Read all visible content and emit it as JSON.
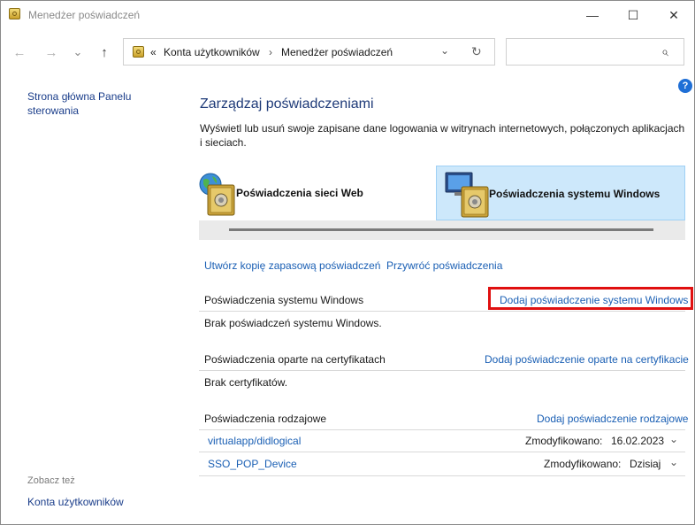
{
  "window": {
    "title": "Menedżer poświadczeń",
    "minimize_glyph": "—",
    "maximize_glyph": "☐",
    "close_glyph": "✕"
  },
  "nav": {
    "back_glyph": "←",
    "forward_glyph": "→",
    "recent_glyph": "⌄",
    "up_glyph": "↑",
    "breadcrumb_overflow": "«",
    "breadcrumb": [
      "Konta użytkowników",
      "Menedżer poświadczeń"
    ],
    "breadcrumb_sep": "›",
    "dropdown_glyph": "⌄",
    "refresh_glyph": "↻",
    "search_placeholder": "",
    "search_glyph": "⌕"
  },
  "sidebar": {
    "home_link": "Strona główna Panelu sterowania",
    "see_also_label": "Zobacz też",
    "see_also_link": "Konta użytkowników"
  },
  "main": {
    "help_glyph": "?",
    "title": "Zarządzaj poświadczeniami",
    "description": "Wyświetl lub usuń swoje zapisane dane logowania w witrynach internetowych, połączonych aplikacjach i sieciach.",
    "tabs": [
      {
        "label": "Poświadczenia sieci Web",
        "icon": "globe-vault-icon",
        "selected": false
      },
      {
        "label": "Poświadczenia systemu Windows",
        "icon": "computer-vault-icon",
        "selected": true
      }
    ],
    "backup_link": "Utwórz kopię zapasową poświadczeń",
    "restore_link": "Przywróć poświadczenia",
    "sections": [
      {
        "title": "Poświadczenia systemu Windows",
        "action": "Dodaj poświadczenie systemu Windows",
        "empty": "Brak poświadczeń systemu Windows."
      },
      {
        "title": "Poświadczenia oparte na certyfikatach",
        "action": "Dodaj poświadczenie oparte na certyfikacie",
        "empty": "Brak certyfikatów."
      },
      {
        "title": "Poświadczenia rodzajowe",
        "action": "Dodaj poświadczenie rodzajowe"
      }
    ],
    "generic_items": [
      {
        "name": "virtualapp/didlogical",
        "modified_label": "Zmodyfikowano:",
        "modified_value": "16.02.2023"
      },
      {
        "name": "SSO_POP_Device",
        "modified_label": "Zmodyfikowano:",
        "modified_value": "Dzisiaj"
      }
    ],
    "expand_glyph": "⌄"
  },
  "colors": {
    "link": "#1a5fb4",
    "selected_tab": "#cde8fb",
    "highlight": "#e01010"
  }
}
